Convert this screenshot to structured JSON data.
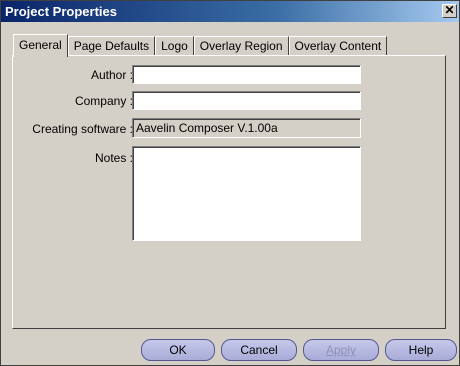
{
  "window": {
    "title": "Project Properties",
    "close_glyph": "✕",
    "accent_color": "#0a246a"
  },
  "tabs": [
    {
      "label": "General",
      "active": true
    },
    {
      "label": "Page Defaults",
      "active": false
    },
    {
      "label": "Logo",
      "active": false
    },
    {
      "label": "Overlay Region",
      "active": false
    },
    {
      "label": "Overlay Content",
      "active": false
    }
  ],
  "general": {
    "author_label": "Author :",
    "author_value": "",
    "company_label": "Company :",
    "company_value": "",
    "software_label": "Creating software :",
    "software_value": "Aavelin Composer V.1.00a",
    "notes_label": "Notes :",
    "notes_value": ""
  },
  "buttons": {
    "ok": "OK",
    "cancel": "Cancel",
    "apply": "Apply",
    "help": "Help"
  }
}
